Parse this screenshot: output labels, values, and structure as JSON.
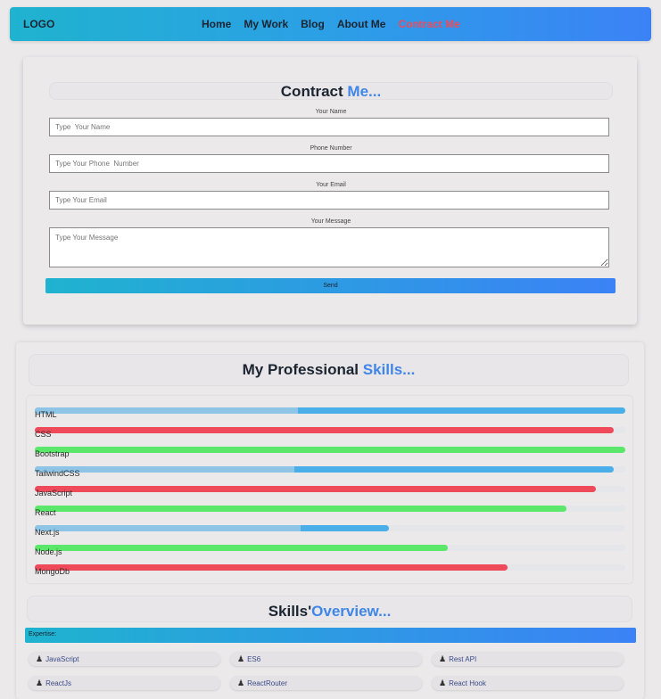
{
  "navbar": {
    "logo": "LOGO",
    "links": [
      "Home",
      "My Work",
      "Blog",
      "About Me",
      "Contract Me"
    ],
    "active_index": 4
  },
  "contact": {
    "title_main": "Contract",
    "title_accent": "Me...",
    "name_label": "Your Name",
    "name_placeholder": "Type  Your Name",
    "phone_label": "Phone Number",
    "phone_placeholder": "Type Your Phone  Number",
    "email_label": "Your Email",
    "email_placeholder": "Type Your Email",
    "message_label": "Your Message",
    "message_placeholder": "Type Your Message",
    "send_label": "Send"
  },
  "skills": {
    "title_main": "My Professional",
    "title_accent": "Skills...",
    "items": [
      {
        "name": "HTML",
        "level": 1.0,
        "color": "#4aaee8",
        "split": 0.445,
        "split_color": "#8ec4e6"
      },
      {
        "name": "CSS",
        "level": 0.98,
        "color": "#ef4a5a"
      },
      {
        "name": "Bootstrap",
        "level": 1.0,
        "color": "#5be86a"
      },
      {
        "name": "TailwindCSS",
        "level": 0.98,
        "color": "#4aaee8",
        "split": 0.44,
        "split_color": "#8ec4e6"
      },
      {
        "name": "JavaScript",
        "level": 0.95,
        "color": "#ef4a5a"
      },
      {
        "name": "React",
        "level": 0.9,
        "color": "#5be86a"
      },
      {
        "name": "Next.js",
        "level": 0.6,
        "color": "#4aaee8",
        "split": 0.45,
        "split_color": "#8ec4e6"
      },
      {
        "name": "Node.js",
        "level": 0.7,
        "color": "#5be86a"
      },
      {
        "name": "MongoDb",
        "level": 0.8,
        "color": "#ef4a5a"
      }
    ]
  },
  "overview": {
    "title_main": "Skills'",
    "title_accent": "Overview...",
    "bar_label": "Expertise:",
    "chips": [
      "JavaScript",
      "ES6",
      "Rest API",
      "ReactJs",
      "ReactRouter",
      "React Hook"
    ],
    "chip_icon": "user-pen-icon"
  }
}
